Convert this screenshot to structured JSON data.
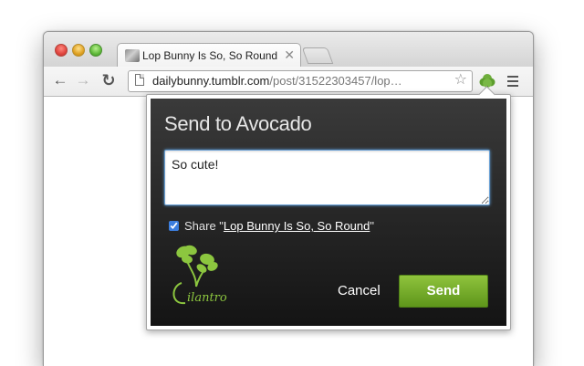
{
  "tab": {
    "title": "Lop Bunny Is So, So Round",
    "close_glyph": "✕",
    "favicon": "bunny-thumbnail"
  },
  "toolbar": {
    "back_glyph": "←",
    "forward_glyph": "→",
    "reload_glyph": "↻",
    "url_host": "dailybunny.tumblr.com",
    "url_path": "/post/31522303457/lop…",
    "star_glyph": "☆",
    "extension_icon": "avocado-icon",
    "menu_icon": "hamburger-menu-icon"
  },
  "popup": {
    "title": "Send to Avocado",
    "message_value": "So cute!",
    "share_checked": true,
    "share_prefix": "Share \"",
    "share_link": "Lop Bunny Is So, So Round",
    "share_suffix": "\"",
    "logo_text": "Cilantro",
    "cancel_label": "Cancel",
    "send_label": "Send"
  },
  "colors": {
    "popup_background": "#1f1f1f",
    "send_button": "#73a92a",
    "logo_green": "#8cc63f",
    "textarea_focus": "#5b9bd5"
  }
}
